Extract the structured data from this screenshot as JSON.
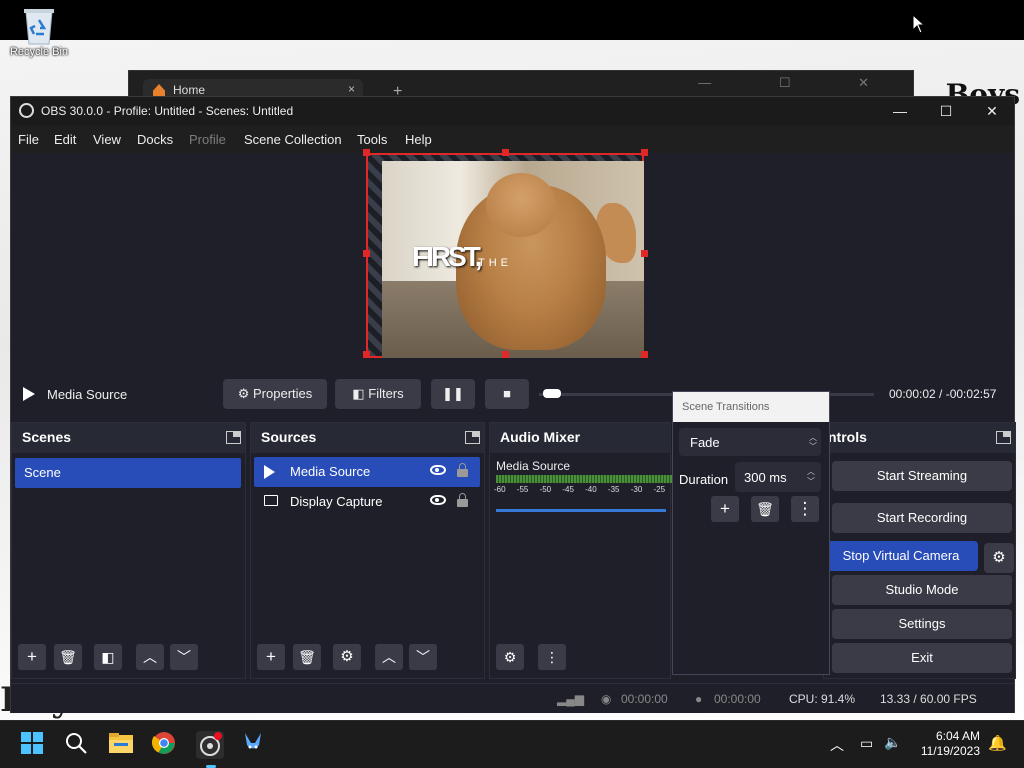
{
  "desktop": {
    "recycle_bin_label": "Recycle Bin",
    "wallpaper_text_right": "Boys",
    "wallpaper_text_bottom": "Boys."
  },
  "background_window": {
    "tab_label": "Home",
    "tab_close": "×",
    "new_tab": "+",
    "controls": "— ☐ ✕"
  },
  "obs": {
    "title": "OBS 30.0.0 - Profile: Untitled - Scenes: Untitled",
    "window_buttons": {
      "minimize": "—",
      "maximize": "☐",
      "close": "✕"
    },
    "menu": [
      "File",
      "Edit",
      "View",
      "Docks",
      "Profile",
      "Scene Collection",
      "Tools",
      "Help"
    ],
    "menu_disabled": [
      "Profile"
    ],
    "preview_overlay_text": "FIRST,",
    "preview_overlay_text2": "THE",
    "media_bar": {
      "source_name": "Media Source",
      "properties_label": "Properties",
      "filters_label": "Filters",
      "time": "00:00:02  /  -00:02:57",
      "progress_fraction": 0.01
    },
    "scenes": {
      "title": "Scenes",
      "items": [
        "Scene"
      ]
    },
    "sources": {
      "title": "Sources",
      "items": [
        {
          "name": "Media Source",
          "icon": "play-icon",
          "visible": true,
          "locked": true,
          "selected": true
        },
        {
          "name": "Display Capture",
          "icon": "monitor-icon",
          "visible": true,
          "locked": true,
          "selected": false
        }
      ]
    },
    "audio_mixer": {
      "title": "Audio Mixer",
      "channel": "Media Source",
      "scale": "-60 -55 -50 -45 -40 -35 -30 -25"
    },
    "scene_transitions": {
      "title": "Scene Transitions",
      "transition": "Fade",
      "duration_label": "Duration",
      "duration_value": "300 ms"
    },
    "controls": {
      "title": "ntrols",
      "start_streaming": "Start Streaming",
      "start_recording": "Start Recording",
      "stop_virtual_camera": "Stop Virtual Camera",
      "studio_mode": "Studio Mode",
      "settings": "Settings",
      "exit": "Exit"
    },
    "status": {
      "stream_time": "00:00:00",
      "record_time": "00:00:00",
      "cpu": "CPU: 91.4%",
      "fps": "13.33 / 60.00 FPS"
    }
  },
  "taskbar": {
    "time": "6:04 AM",
    "date": "11/19/2023",
    "apps": [
      "windows-start-icon",
      "search-icon",
      "file-explorer-icon",
      "chrome-icon",
      "obs-icon",
      "app-rabbit-icon"
    ]
  },
  "colors": {
    "accent": "#284cb8",
    "selection_border": "#e12727",
    "panel": "#1e1f29",
    "dock_header": "#272934"
  }
}
